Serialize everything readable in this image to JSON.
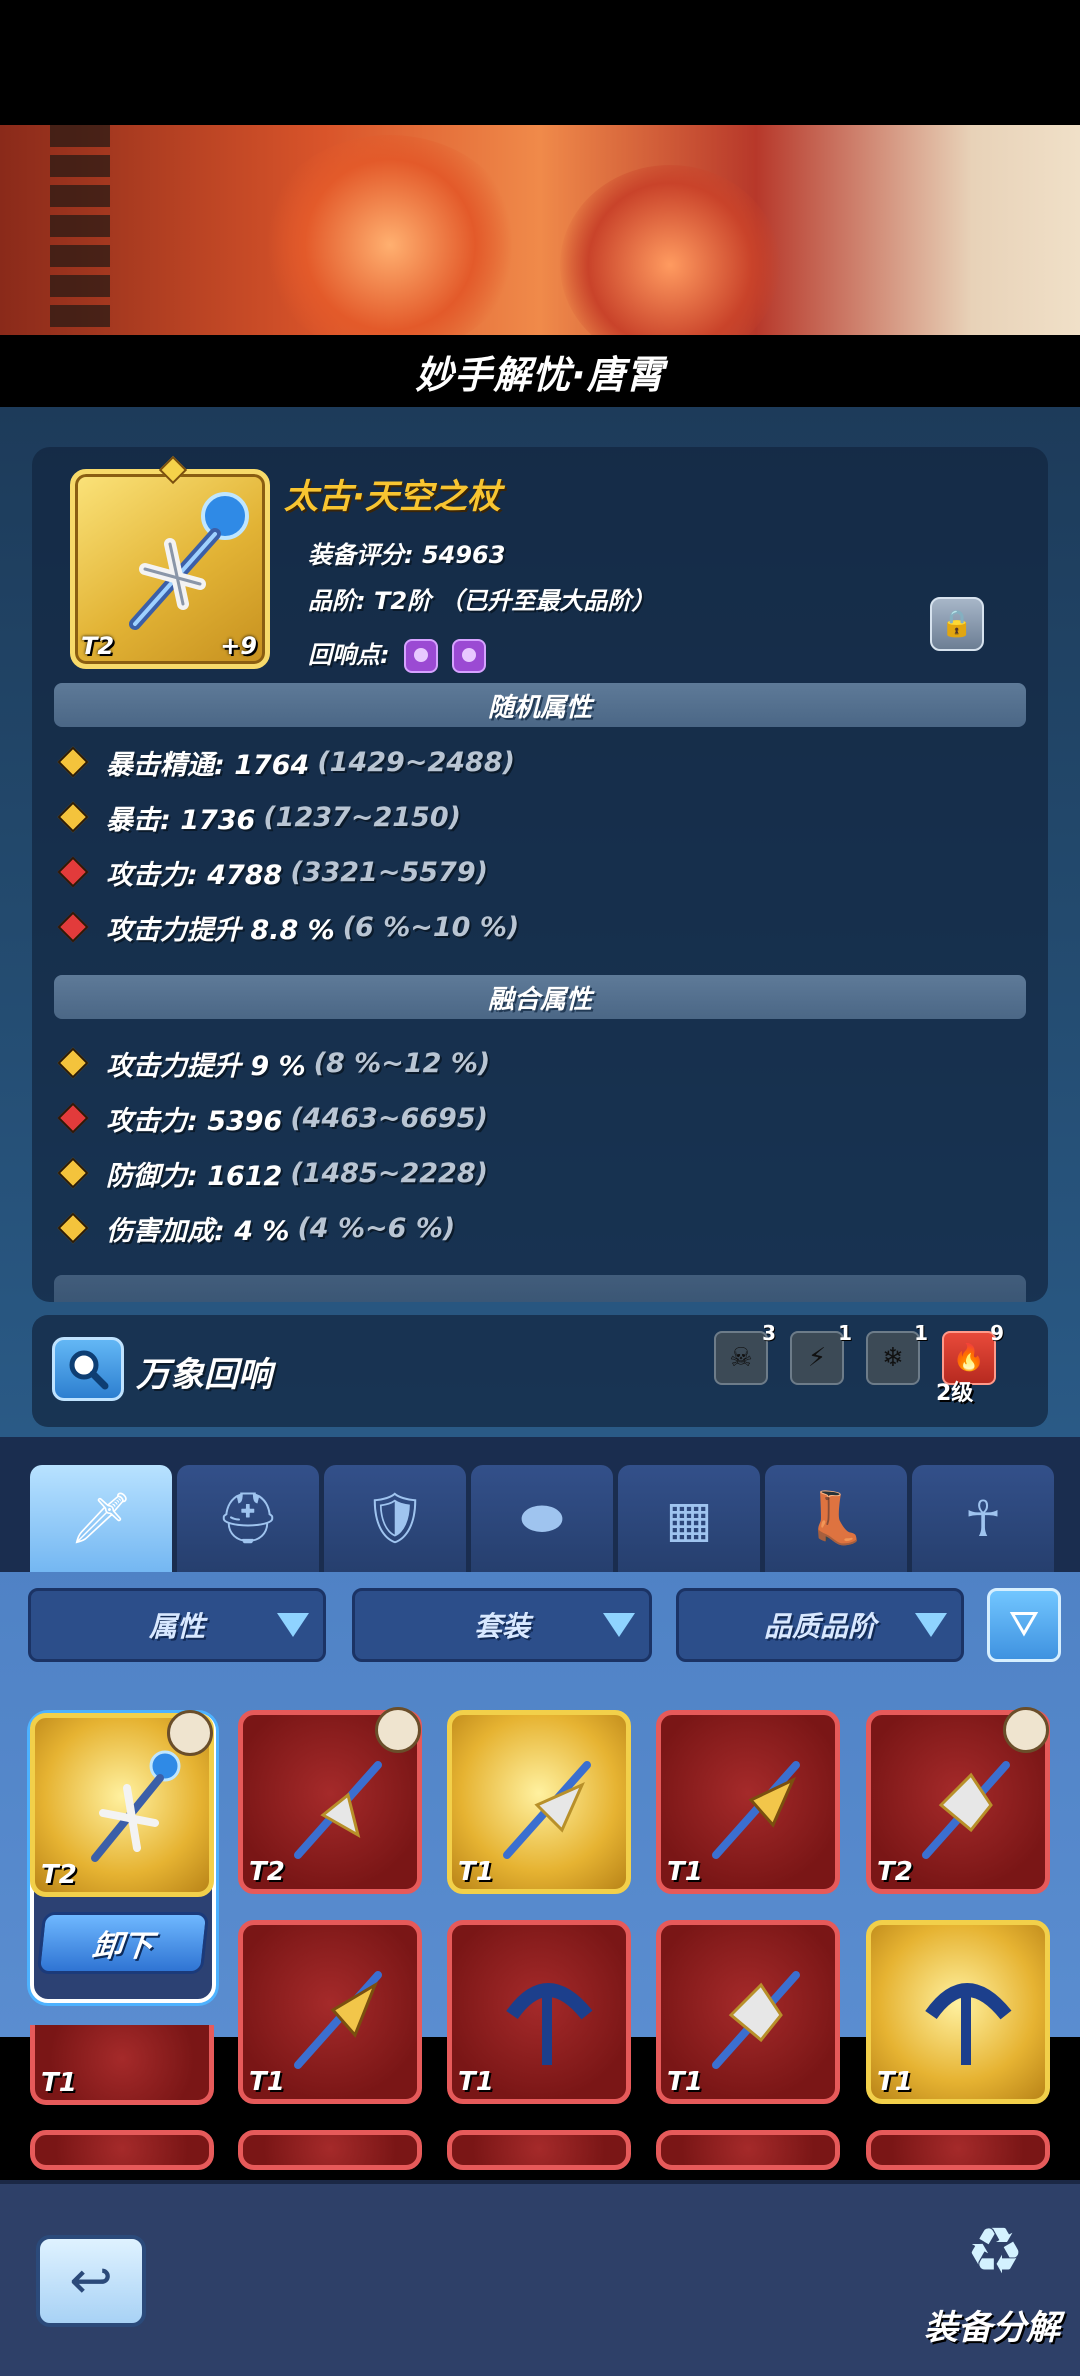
{
  "hero": {
    "title": "妙手解忧·唐霄"
  },
  "equipment": {
    "name": "太古·天空之杖",
    "score_line": "装备评分: 54963",
    "grade_line": "品阶: T2阶 （已升至最大品阶）",
    "echo_label": "回响点:",
    "icon_tier": "T2",
    "icon_level": "+9"
  },
  "random_attrs": {
    "header": "随机属性",
    "items": [
      {
        "label": "暴击精通: 1764",
        "range": "(1429~2488)",
        "color": "gold"
      },
      {
        "label": "暴击: 1736",
        "range": "(1237~2150)",
        "color": "gold"
      },
      {
        "label": "攻击力: 4788",
        "range": "(3321~5579)",
        "color": "red"
      },
      {
        "label": "攻击力提升 8.8 %",
        "range": "(6 %~10 %)",
        "color": "red"
      }
    ]
  },
  "fusion_attrs": {
    "header": "融合属性",
    "items": [
      {
        "label": "攻击力提升 9 %",
        "range": "(8 %~12 %)",
        "color": "gold"
      },
      {
        "label": "攻击力: 5396",
        "range": "(4463~6695)",
        "color": "red"
      },
      {
        "label": "防御力: 1612",
        "range": "(1485~2228)",
        "color": "gold"
      },
      {
        "label": "伤害加成: 4 %",
        "range": "(4 %~6 %)",
        "color": "gold"
      }
    ]
  },
  "echo_panel": {
    "title": "万象回响",
    "slots": [
      {
        "count": "3",
        "icon": "skull-icon"
      },
      {
        "count": "1",
        "icon": "lightning-icon"
      },
      {
        "count": "1",
        "icon": "snowflake-icon"
      },
      {
        "count": "9",
        "icon": "fire-icon",
        "level": "2级"
      }
    ]
  },
  "tabs": [
    "weapon",
    "helmet",
    "armor",
    "bracer",
    "pants",
    "boots",
    "necklace"
  ],
  "filters": {
    "attribute": "属性",
    "set": "套装",
    "quality": "品质品阶"
  },
  "inventory": {
    "unequip_label": "卸下",
    "row1": [
      "T2",
      "T2",
      "T1",
      "T1",
      "T2"
    ],
    "row2": [
      "T1",
      "T1",
      "T1",
      "T1",
      "T1"
    ]
  },
  "footer": {
    "decompose_label": "装备分解"
  }
}
